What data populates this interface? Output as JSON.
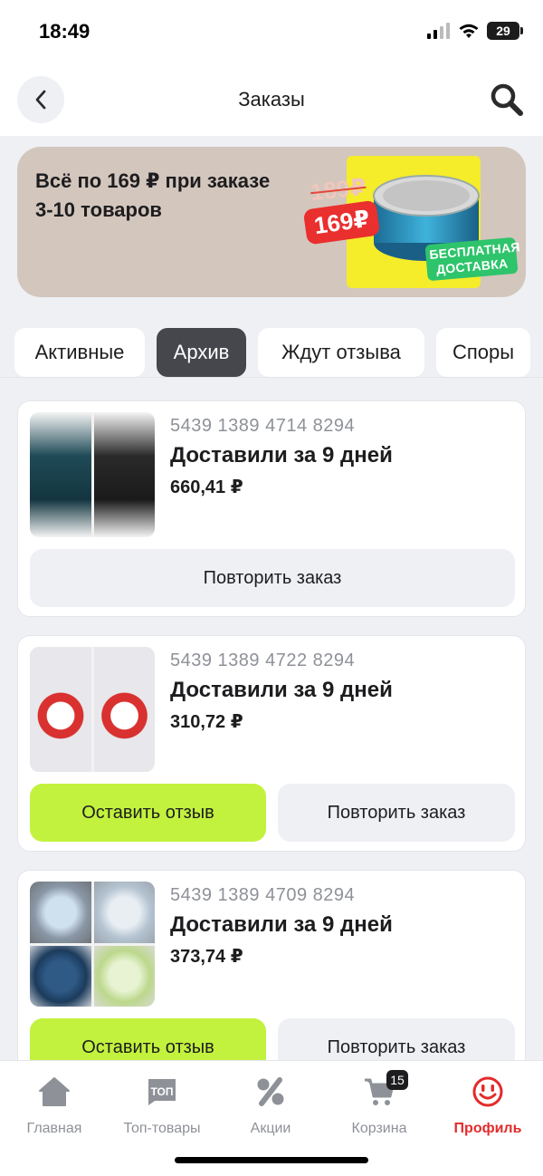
{
  "status_bar": {
    "time": "18:49",
    "battery": "29"
  },
  "header": {
    "title": "Заказы"
  },
  "promo": {
    "text": "Всё по 169 ₽ при заказе 3-10 товаров",
    "old_price": "189₽",
    "new_price": "169₽",
    "badge": "БЕСПЛАТНАЯ ДОСТАВКА"
  },
  "tabs": [
    {
      "label": "Активные",
      "active": false
    },
    {
      "label": "Архив",
      "active": true
    },
    {
      "label": "Ждут отзыва",
      "active": false
    },
    {
      "label": "Споры",
      "active": false
    }
  ],
  "orders": [
    {
      "number": "5439 1389 4714 8294",
      "status": "Доставили за 9 дней",
      "price": "660,41 ₽",
      "buttons": [
        "Повторить заказ"
      ]
    },
    {
      "number": "5439 1389 4722 8294",
      "status": "Доставили за 9 дней",
      "price": "310,72 ₽",
      "buttons": [
        "Оставить отзыв",
        "Повторить заказ"
      ]
    },
    {
      "number": "5439 1389 4709 8294",
      "status": "Доставили за 9 дней",
      "price": "373,74 ₽",
      "buttons": [
        "Оставить отзыв",
        "Повторить заказ"
      ]
    }
  ],
  "bottom_nav": [
    {
      "label": "Главная",
      "icon": "home-icon"
    },
    {
      "label": "Топ-товары",
      "icon": "top-icon",
      "icon_text": "ТОП"
    },
    {
      "label": "Акции",
      "icon": "percent-icon"
    },
    {
      "label": "Корзина",
      "icon": "cart-icon",
      "badge": "15"
    },
    {
      "label": "Профиль",
      "icon": "profile-icon",
      "active": true
    }
  ],
  "colors": {
    "accent_green": "#c2f23d",
    "active_red": "#e32b2b",
    "tab_active": "#45474d"
  }
}
